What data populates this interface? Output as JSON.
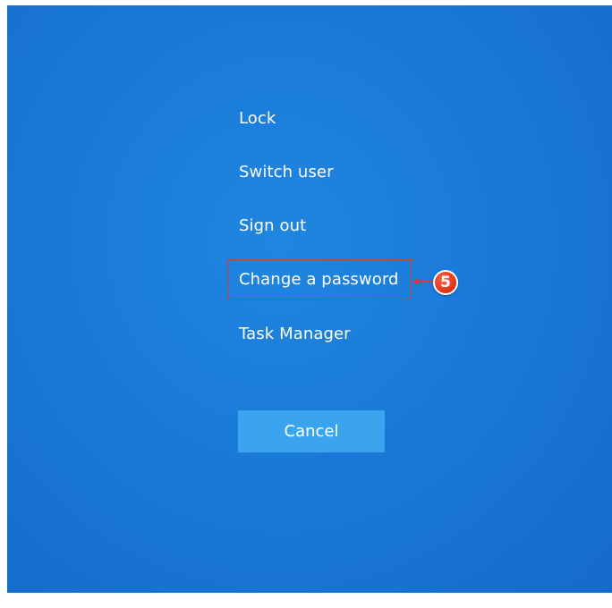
{
  "menu": {
    "items": [
      {
        "label": "Lock"
      },
      {
        "label": "Switch user"
      },
      {
        "label": "Sign out"
      },
      {
        "label": "Change a password"
      },
      {
        "label": "Task Manager"
      }
    ]
  },
  "cancel_button": {
    "label": "Cancel"
  },
  "annotation": {
    "step_number": "5"
  },
  "colors": {
    "background": "#1a79d8",
    "cancel_button": "#3aa4ee",
    "highlight": "#d33a3a",
    "badge": "#e53a1f",
    "text": "#ffffff"
  }
}
